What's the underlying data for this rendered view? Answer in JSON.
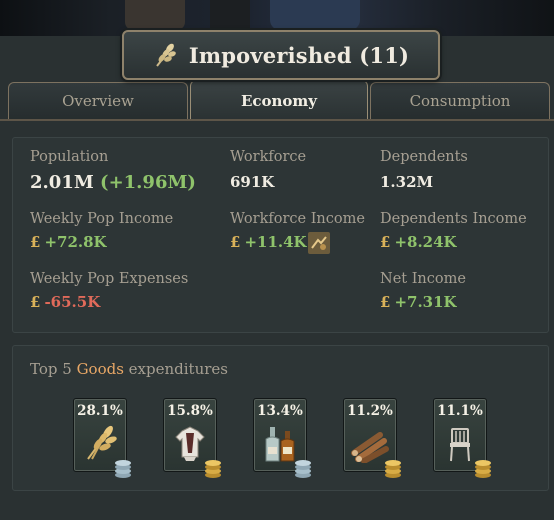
{
  "header": {
    "title": "Impoverished (11)",
    "icon": "wheat-icon"
  },
  "tabs": [
    {
      "label": "Overview",
      "active": false
    },
    {
      "label": "Economy",
      "active": true
    },
    {
      "label": "Consumption",
      "active": false
    }
  ],
  "stats": {
    "population": {
      "label": "Population",
      "value": "2.01M",
      "change": "(+1.96M)"
    },
    "workforce": {
      "label": "Workforce",
      "value": "691K"
    },
    "dependents": {
      "label": "Dependents",
      "value": "1.32M"
    },
    "weekly_income": {
      "label": "Weekly Pop Income",
      "currency": "£",
      "value": "+72.8K"
    },
    "workforce_income": {
      "label": "Workforce Income",
      "currency": "£",
      "value": "+11.4K"
    },
    "dependents_income": {
      "label": "Dependents Income",
      "currency": "£",
      "value": "+8.24K"
    },
    "weekly_expenses": {
      "label": "Weekly Pop Expenses",
      "currency": "£",
      "value": "-65.5K"
    },
    "net_income": {
      "label": "Net Income",
      "currency": "£",
      "value": "+7.31K"
    }
  },
  "goods": {
    "title_prefix": "Top 5 ",
    "title_highlight": "Goods",
    "title_suffix": " expenditures",
    "items": [
      {
        "percent": "28.1%",
        "icon": "grain-icon",
        "coin": "silver"
      },
      {
        "percent": "15.8%",
        "icon": "clothes-icon",
        "coin": "gold"
      },
      {
        "percent": "13.4%",
        "icon": "liquor-icon",
        "coin": "silver"
      },
      {
        "percent": "11.2%",
        "icon": "wood-icon",
        "coin": "gold"
      },
      {
        "percent": "11.1%",
        "icon": "furniture-icon",
        "coin": "gold"
      }
    ]
  },
  "colors": {
    "positive": "#8fc36b",
    "negative": "#e06a5a",
    "highlight": "#e8a766",
    "gold": "#d9b25a"
  }
}
